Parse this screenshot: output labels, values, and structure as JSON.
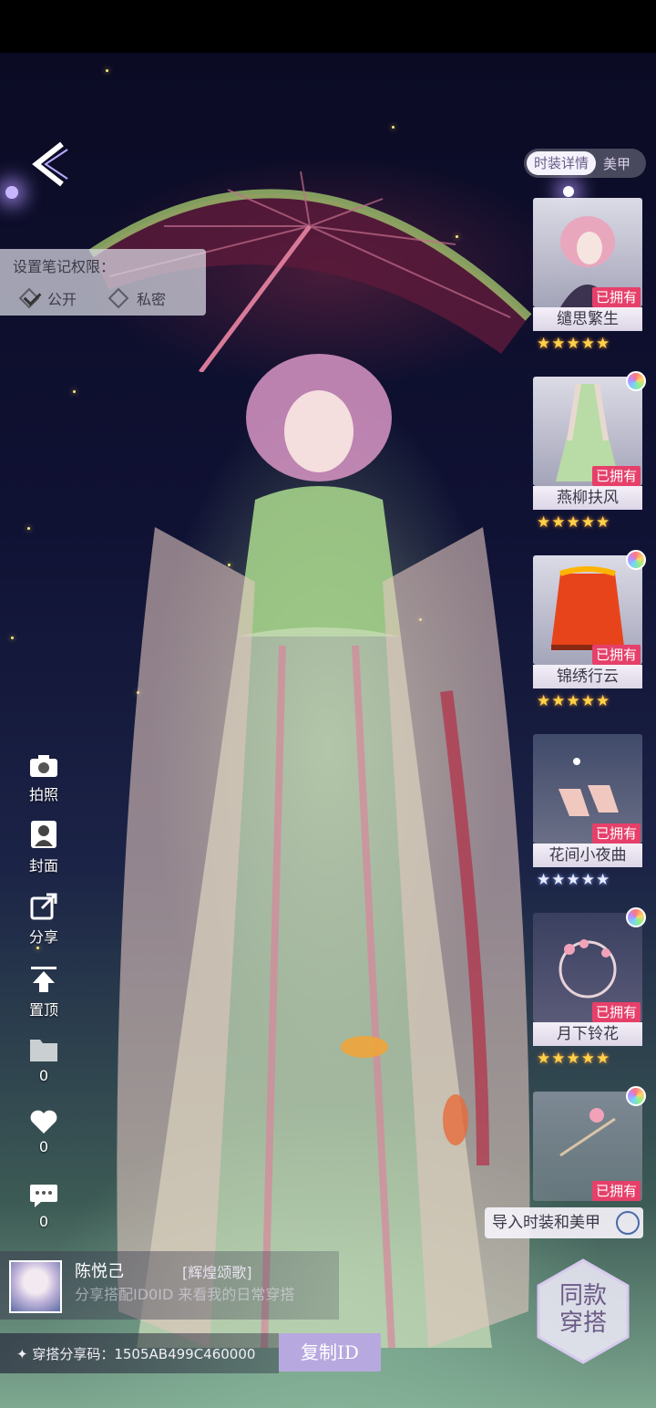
{
  "tabs": {
    "active": "时装详情",
    "inactive": "美甲"
  },
  "permission": {
    "title": "设置笔记权限：",
    "options": [
      {
        "label": "公开",
        "checked": true
      },
      {
        "label": "私密",
        "checked": false
      }
    ]
  },
  "sidebar": {
    "photo": "拍照",
    "cover": "封面",
    "share": "分享",
    "pin": "置顶",
    "collect_count": "0",
    "like_count": "0",
    "comment_count": "0"
  },
  "items": [
    {
      "name": "缱思繁生",
      "status": "已拥有",
      "stars": "★★★★★",
      "star_color": "gold",
      "rainbow": false
    },
    {
      "name": "燕柳扶风",
      "status": "已拥有",
      "stars": "★★★★★",
      "star_color": "gold",
      "rainbow": true
    },
    {
      "name": "锦绣行云",
      "status": "已拥有",
      "stars": "★★★★★",
      "star_color": "gold",
      "rainbow": true
    },
    {
      "name": "花间小夜曲",
      "status": "已拥有",
      "stars": "★★★★★",
      "star_color": "white",
      "rainbow": false
    },
    {
      "name": "月下铃花",
      "status": "已拥有",
      "stars": "★★★★★",
      "star_color": "gold",
      "rainbow": true
    },
    {
      "name": "",
      "status": "已拥有",
      "stars": "",
      "star_color": "gold",
      "rainbow": true
    }
  ],
  "import_button": "导入时装和美甲",
  "same_outfit_button": {
    "line1": "同款",
    "line2": "穿搭"
  },
  "profile": {
    "username": "陈悦己",
    "badge": "[辉煌颂歌]",
    "description": "分享搭配ID0ID 来看我的日常穿搭"
  },
  "share": {
    "code_label": "✦ 穿搭分享码：1505AB499C460000",
    "copy_button": "复制ID"
  },
  "colors": {
    "owned": "#e6406a",
    "accent": "#b7a9df",
    "star_gold": "#ffd24a"
  }
}
